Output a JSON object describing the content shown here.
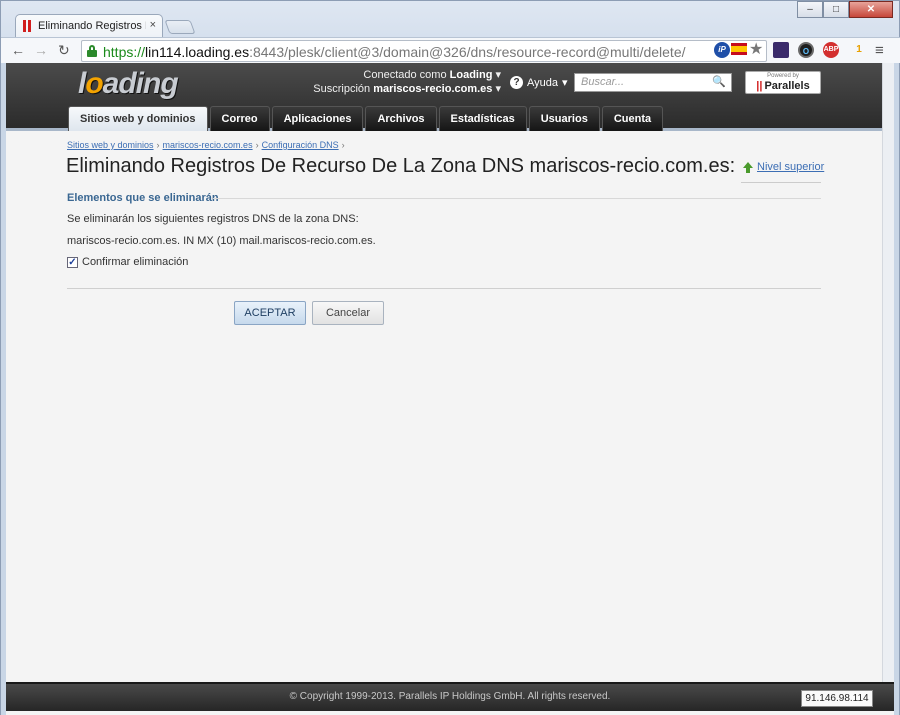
{
  "browser": {
    "tab_title": "Eliminando Registros De R",
    "tab_close": "×",
    "url_scheme": "https://",
    "url_host": "lin114.loading.es",
    "url_path": ":8443/plesk/client@3/domain@326/dns/resource-record@multi/delete/",
    "window_buttons": [
      "–",
      "□",
      "✕"
    ],
    "extensions": [
      "iP",
      "ES",
      "★",
      "O",
      "ABP",
      "1"
    ]
  },
  "header": {
    "logo_text": "loading",
    "connected_label": "Conectado como",
    "connected_user": "Loading",
    "subscription_label": "Suscripción",
    "subscription_value": "mariscos-recio.com.es",
    "help_label": "Ayuda",
    "search_placeholder": "Buscar...",
    "parallels_powered": "Powered by",
    "parallels_name": "Parallels"
  },
  "nav": {
    "tabs": [
      "Sitios web y dominios",
      "Correo",
      "Aplicaciones",
      "Archivos",
      "Estadísticas",
      "Usuarios",
      "Cuenta"
    ],
    "active_tab": "Sitios web y dominios"
  },
  "breadcrumb": [
    "Sitios web y dominios",
    "mariscos-recio.com.es",
    "Configuración DNS"
  ],
  "main": {
    "title": "Eliminando Registros De Recurso De La Zona DNS mariscos-recio.com.es:",
    "up_level": "Nivel superior",
    "section_title": "Elementos que se eliminarán",
    "intro_text": "Se eliminarán los siguientes registros DNS de la zona DNS:",
    "record_text": "mariscos-recio.com.es.  IN MX (10) mail.mariscos-recio.com.es.",
    "confirm_label": "Confirmar eliminación",
    "confirm_checked": true,
    "ok_button": "ACEPTAR",
    "cancel_button": "Cancelar"
  },
  "footer": {
    "copyright": "© Copyright 1999-2013. Parallels IP Holdings GmbH. All rights reserved.",
    "ip": "91.146.98.114"
  },
  "colors": {
    "header_bg": "#2b2b2b",
    "link": "#3c6eb4",
    "section_title": "#3a6792",
    "secure_green": "#1a8a1a"
  }
}
